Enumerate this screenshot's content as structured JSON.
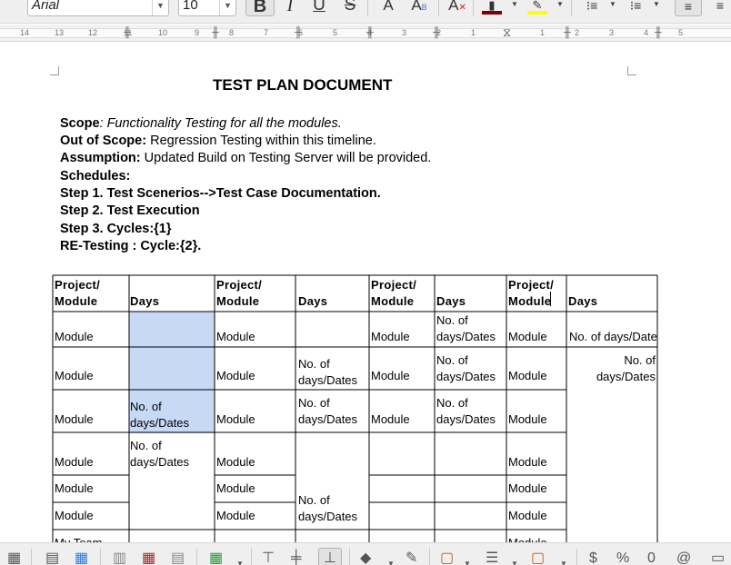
{
  "toolbar": {
    "font_name": "Arial",
    "font_size": "10",
    "bold_label": "B",
    "italic_label": "I",
    "underline_label": "U",
    "strike_label": "S",
    "grow_label": "A",
    "subscript_label": "A",
    "subscript_sub": "B",
    "clear_label": "A",
    "font_color": "#800000",
    "highlight_color": "#ffff00"
  },
  "ruler": {
    "numbers": [
      "14",
      "13",
      "12",
      "11",
      "10",
      "9",
      "8",
      "7",
      "6",
      "5",
      "4",
      "3",
      "2",
      "1",
      "1",
      "2",
      "3",
      "4",
      "5"
    ]
  },
  "document": {
    "title": "TEST PLAN DOCUMENT",
    "lines": [
      {
        "bold": "Scope",
        "italic": ": Functionality Testing for all the modules.",
        "normal": ""
      },
      {
        "bold": "Out of Scope:",
        "italic": "",
        "normal": " Regression Testing within this timeline."
      },
      {
        "bold": "Assumption:",
        "italic": "",
        "normal": " Updated Build on Testing Server will be provided."
      },
      {
        "bold": "Schedules:",
        "italic": "",
        "normal": ""
      },
      {
        "bold": "Step 1. Test Scenerios-->Test Case Documentation.",
        "italic": "",
        "normal": ""
      },
      {
        "bold": "Step 2. Test Execution",
        "italic": "",
        "normal": ""
      },
      {
        "bold": "Step 3. Cycles:{1}",
        "italic": "",
        "normal": ""
      },
      {
        "bold": "RE-Testing : Cycle:{2}.",
        "italic": "",
        "normal": ""
      }
    ]
  },
  "table": {
    "header_project": "Project/",
    "header_module": "Module",
    "header_days": "Days",
    "module": "Module",
    "no_of": "No. of",
    "days_dates": "days/Dates",
    "no_of_days_dates": "No. of days/Date",
    "my_team_partial": "My Team",
    "selection_color": "#c6d9f5"
  }
}
